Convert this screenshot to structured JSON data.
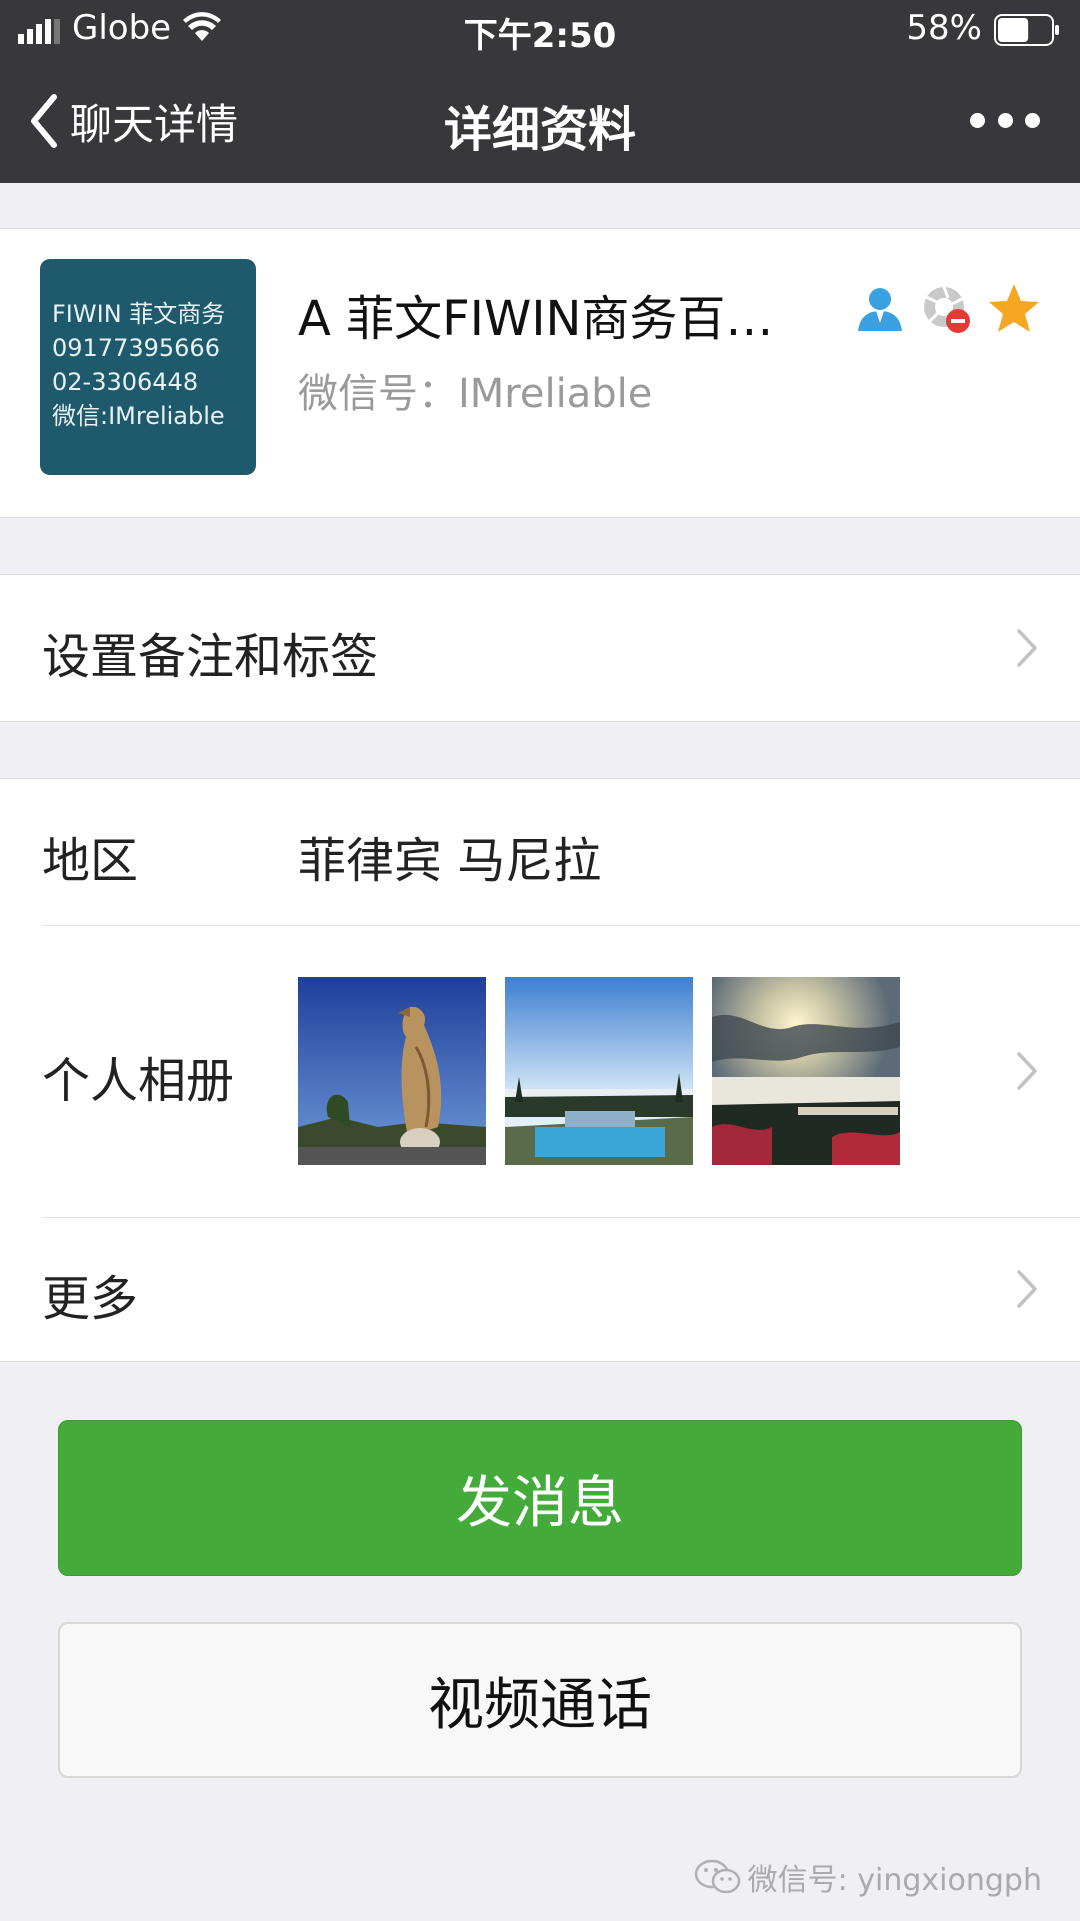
{
  "status_bar": {
    "carrier": "Globe",
    "time": "下午2:50",
    "battery_percent": "58%",
    "battery_level": 0.58
  },
  "nav": {
    "back_label": "聊天详情",
    "title": "详细资料"
  },
  "profile": {
    "avatar_lines": [
      "FIWIN 菲文商务",
      "09177395666",
      "02-3306448",
      "微信:IMreliable"
    ],
    "name": "A 菲文FIWIN商务百…",
    "wechat_id_label": "微信号：",
    "wechat_id": "IMreliable",
    "badges": [
      "contact-icon",
      "blocked-icon",
      "star-icon"
    ],
    "colors": {
      "contact": "#3aa0e0",
      "blocked": "#e53935",
      "star": "#f5a623"
    }
  },
  "remark_row": {
    "label": "设置备注和标签"
  },
  "region_row": {
    "label": "地区",
    "value": "菲律宾 马尼拉"
  },
  "album_row": {
    "label": "个人相册"
  },
  "more_row": {
    "label": "更多"
  },
  "buttons": {
    "send_message": "发消息",
    "video_call": "视频通话"
  },
  "watermark": "微信号: yingxiongph",
  "colors": {
    "nav_bg": "#38373c",
    "primary_green": "#44ab3b",
    "page_bg": "#efeff4"
  }
}
